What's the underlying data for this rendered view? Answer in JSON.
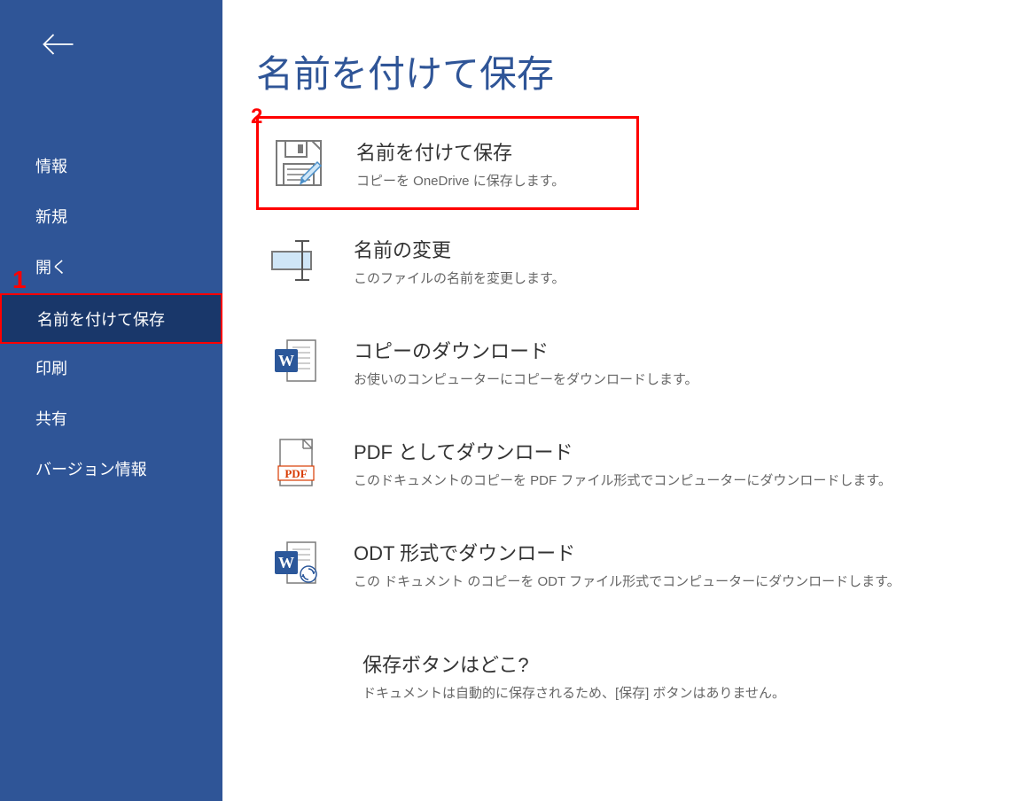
{
  "sidebar": {
    "items": [
      {
        "label": "情報",
        "active": false
      },
      {
        "label": "新規",
        "active": false
      },
      {
        "label": "開く",
        "active": false
      },
      {
        "label": "名前を付けて保存",
        "active": true
      },
      {
        "label": "印刷",
        "active": false
      },
      {
        "label": "共有",
        "active": false
      },
      {
        "label": "バージョン情報",
        "active": false
      }
    ]
  },
  "main": {
    "title": "名前を付けて保存",
    "options": [
      {
        "title": "名前を付けて保存",
        "desc": "コピーを OneDrive に保存します。",
        "highlighted": true
      },
      {
        "title": "名前の変更",
        "desc": "このファイルの名前を変更します。"
      },
      {
        "title": "コピーのダウンロード",
        "desc": "お使いのコンピューターにコピーをダウンロードします。"
      },
      {
        "title": "PDF としてダウンロード",
        "desc": "このドキュメントのコピーを PDF ファイル形式でコンピューターにダウンロードします。"
      },
      {
        "title": "ODT 形式でダウンロード",
        "desc": "この ドキュメント のコピーを ODT ファイル形式でコンピューターにダウンロードします。"
      }
    ],
    "info": {
      "title": "保存ボタンはどこ?",
      "desc": "ドキュメントは自動的に保存されるため、[保存] ボタンはありません。"
    }
  },
  "annotations": {
    "one": "1",
    "two": "2"
  }
}
